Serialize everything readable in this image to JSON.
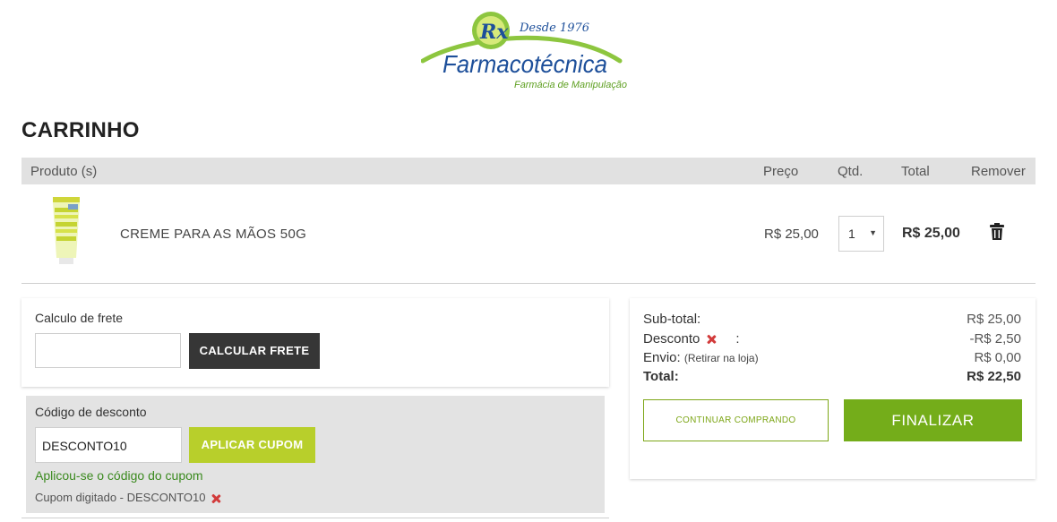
{
  "brand": {
    "name": "Farmacotécnica",
    "since": "Desde 1976",
    "tagline": "Farmácia de Manipulação",
    "badge": "Rx",
    "colors": {
      "blue": "#1d4f9a",
      "green": "#8dc63f"
    }
  },
  "page_title": "CARRINHO",
  "table": {
    "headers": {
      "product": "Produto (s)",
      "price": "Preço",
      "qty": "Qtd.",
      "total": "Total",
      "remove": "Remover"
    },
    "rows": [
      {
        "name": "CREME PARA AS MÃOS 50G",
        "price": "R$ 25,00",
        "qty": "1",
        "total": "R$ 25,00",
        "thumb_icon": "hand-cream-tube-icon",
        "remove_icon": "trash-icon"
      }
    ]
  },
  "shipping": {
    "label": "Calculo de frete",
    "input_value": "",
    "button": "CALCULAR FRETE"
  },
  "coupon": {
    "label": "Código de desconto",
    "input_value": "DESCONTO10",
    "button": "APLICAR CUPOM",
    "success": "Aplicou-se o código do cupom",
    "typed": "Cupom digitado - DESCONTO10"
  },
  "summary": {
    "subtotal_label": "Sub-total:",
    "subtotal": "R$ 25,00",
    "discount_label": "Desconto",
    "discount_colon": ":",
    "discount": "-R$ 2,50",
    "shipping_label": "Envio:",
    "shipping_note": "(Retirar na loja)",
    "shipping": "R$ 0,00",
    "total_label": "Total:",
    "total": "R$ 22,50",
    "continue_button": "CONTINUAR COMPRANDO",
    "finalize_button": "FINALIZAR"
  },
  "colors": {
    "header_gray": "#e1e1e1",
    "dark_button": "#363636",
    "lime_button": "#b8cf2b",
    "finalize_green": "#74ad1a",
    "success_green": "#3b8a1f",
    "remove_red": "#d23b3b"
  }
}
